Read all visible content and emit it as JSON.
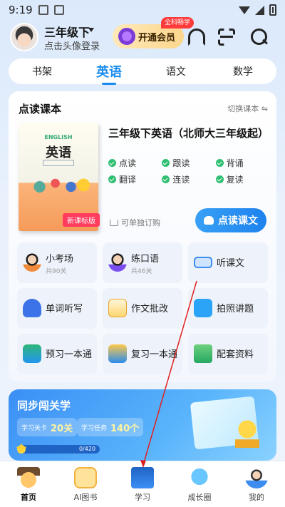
{
  "status": {
    "time": "9:19"
  },
  "header": {
    "grade": "三年级下",
    "login_hint": "点击头像登录",
    "vip_label": "开通会员",
    "vip_tag": "全科畅学",
    "icons": [
      "headset-icon",
      "scan-icon",
      "search-icon"
    ]
  },
  "tabs": [
    {
      "label": "书架",
      "active": false
    },
    {
      "label": "英语",
      "active": true
    },
    {
      "label": "语文",
      "active": false
    },
    {
      "label": "数学",
      "active": false
    }
  ],
  "reader": {
    "title": "点读课本",
    "switch_label": "切换课本",
    "book_cover_en": "ENGLISH",
    "book_cover_cn": "英语",
    "book_badge": "新课标版",
    "book_name": "三年级下英语（北师大三年级起）",
    "features": [
      "点读",
      "跟读",
      "背诵",
      "翻译",
      "连读",
      "复读"
    ],
    "buy_label": "可单独订购",
    "read_button": "点读课文"
  },
  "tools": [
    {
      "label": "小考场",
      "sub": "共90关",
      "icon": "student-icon"
    },
    {
      "label": "练口语",
      "sub": "共46关",
      "icon": "speaking-student-icon"
    },
    {
      "label": "听课文",
      "sub": "",
      "icon": "listen-icon"
    },
    {
      "label": "单词听写",
      "sub": "",
      "icon": "dictation-icon"
    },
    {
      "label": "作文批改",
      "sub": "",
      "icon": "essay-icon"
    },
    {
      "label": "拍照讲题",
      "sub": "",
      "icon": "photo-icon"
    },
    {
      "label": "预习一本通",
      "sub": "",
      "icon": "preview-book-icon"
    },
    {
      "label": "复习一本通",
      "sub": "",
      "icon": "review-book-icon"
    },
    {
      "label": "配套资料",
      "sub": "",
      "icon": "folder-icon"
    }
  ],
  "banner": {
    "title": "同步闯关学",
    "levels_label": "学习关卡",
    "levels_value": "20关",
    "tasks_label": "学习任务",
    "tasks_value": "140个",
    "progress_text": "0/420",
    "progress_fraction": 0.0
  },
  "bottom_nav": [
    {
      "label": "首页",
      "active": true
    },
    {
      "label": "AI图书",
      "active": false
    },
    {
      "label": "学习",
      "active": false
    },
    {
      "label": "成长圈",
      "active": false
    },
    {
      "label": "我的",
      "active": false
    }
  ],
  "colors": {
    "accent": "#1a8cf0",
    "vip": "#fcd68c",
    "badge": "#ff3b3b",
    "arrow": "#e02020"
  }
}
